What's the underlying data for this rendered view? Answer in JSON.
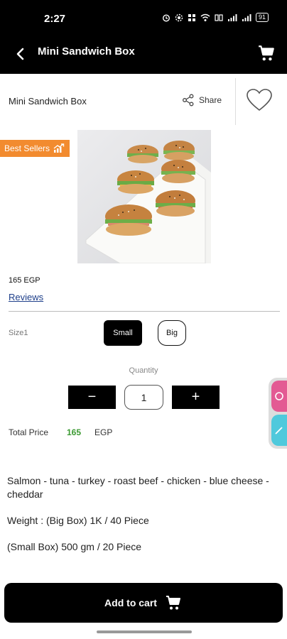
{
  "status": {
    "time": "2:27",
    "battery": "91"
  },
  "appbar": {
    "title": "Mini Sandwich Box"
  },
  "product": {
    "title": "Mini Sandwich Box",
    "share_label": "Share",
    "badge": "Best Sellers",
    "price": "165 EGP",
    "reviews_label": "Reviews"
  },
  "size": {
    "label": "Size1",
    "options": [
      "Small",
      "Big"
    ],
    "selected": "Small"
  },
  "quantity": {
    "label": "Quantity",
    "minus": "−",
    "value": "1",
    "plus": "+"
  },
  "total": {
    "label": "Total Price",
    "value": "165",
    "currency": "EGP"
  },
  "description": {
    "ingredients": "Salmon - tuna - turkey - roast beef - chicken - blue cheese - cheddar",
    "weight_big": "Weight : (Big Box) 1K / 40 Piece",
    "weight_small": "(Small Box) 500 gm / 20 Piece"
  },
  "cta": {
    "add_to_cart": "Add to cart"
  },
  "colors": {
    "accent": "#000000",
    "badge": "#f28b2f",
    "price_green": "#3b9a32",
    "link": "#1e3f8a"
  }
}
